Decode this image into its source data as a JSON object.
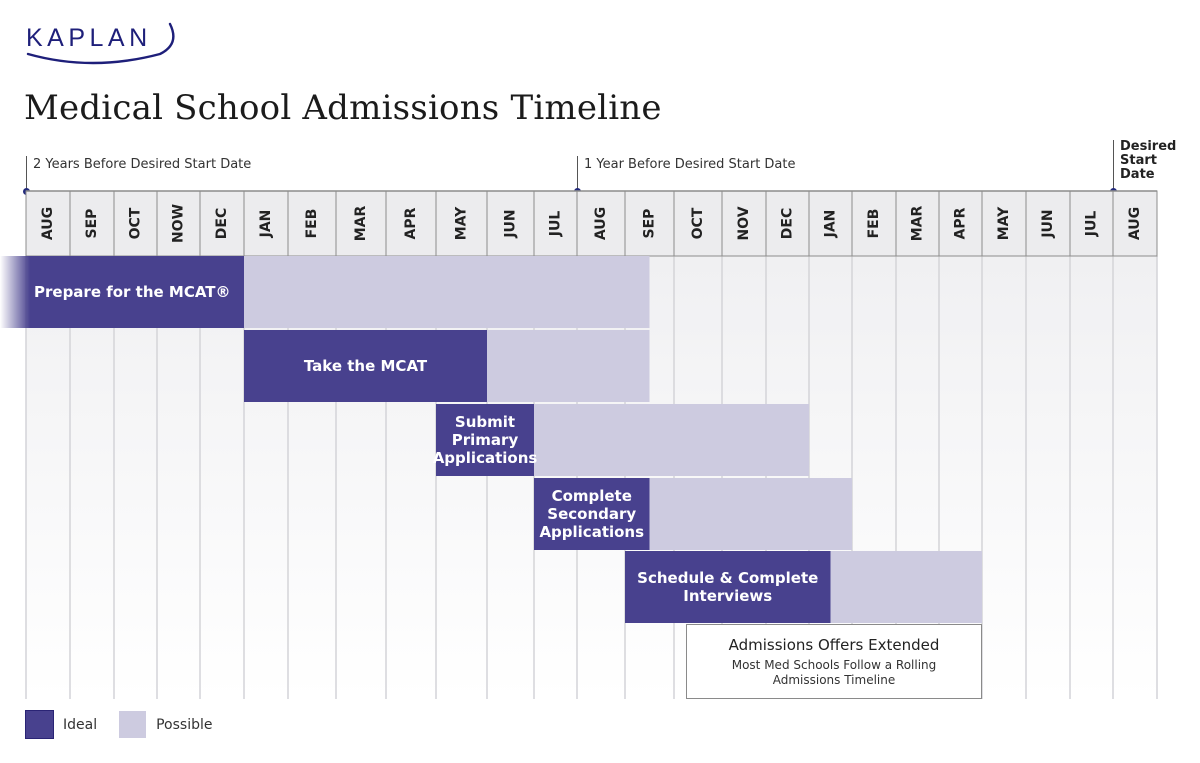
{
  "logo": {
    "text": "KAPLAN"
  },
  "title": "Medical School Admissions Timeline",
  "markers": [
    {
      "label": "2 Years Before Desired Start Date",
      "month_index": 0
    },
    {
      "label": "1 Year Before Desired Start Date",
      "month_index": 12
    },
    {
      "label_lines": [
        "Desired",
        "Start",
        "Date"
      ],
      "month_index": 24
    }
  ],
  "colors": {
    "ideal": "#48418e",
    "possible": "#cdcbe0",
    "header_bg": "#ececee",
    "grid_line": "#d4d4d8",
    "marker_dot": "#232a7c"
  },
  "legend": [
    {
      "key": "ideal",
      "label": "Ideal"
    },
    {
      "key": "possible",
      "label": "Possible"
    }
  ],
  "chart_data": {
    "type": "gantt",
    "title": "Medical School Admissions Timeline",
    "months": [
      "AUG",
      "SEP",
      "OCT",
      "NOW",
      "DEC",
      "JAN",
      "FEB",
      "MAR",
      "APR",
      "MAY",
      "JUN",
      "JUL",
      "AUG",
      "SEP",
      "OCT",
      "NOV",
      "DEC",
      "JAN",
      "FEB",
      "MAR",
      "APR",
      "MAY",
      "JUN",
      "JUL",
      "AUG"
    ],
    "unit": "month index from AUG two years before desired start (0) to desired start AUG (24)",
    "tasks": [
      {
        "label": "Prepare for the MCAT®",
        "ideal": [
          -0.5,
          5
        ],
        "possible": [
          5,
          13.5
        ],
        "label_align": "left"
      },
      {
        "label": "Take the MCAT",
        "ideal": [
          5,
          10
        ],
        "possible": [
          10,
          13.5
        ]
      },
      {
        "label_lines": [
          "Submit",
          "Primary",
          "Applications"
        ],
        "ideal": [
          9,
          11
        ],
        "possible": [
          11,
          17
        ]
      },
      {
        "label_lines": [
          "Complete",
          "Secondary",
          "Applications"
        ],
        "ideal": [
          11,
          13.5
        ],
        "possible": [
          13.5,
          18
        ]
      },
      {
        "label_lines": [
          "Schedule & Complete",
          "Interviews"
        ],
        "ideal": [
          13,
          17.5
        ],
        "possible": [
          17.5,
          21
        ]
      }
    ],
    "note": {
      "title": "Admissions Offers Extended",
      "subtitle_lines": [
        "Most Med Schools Follow a Rolling",
        "Admissions Timeline"
      ],
      "span": [
        14.5,
        21
      ]
    },
    "legend_position": "bottom-left"
  }
}
